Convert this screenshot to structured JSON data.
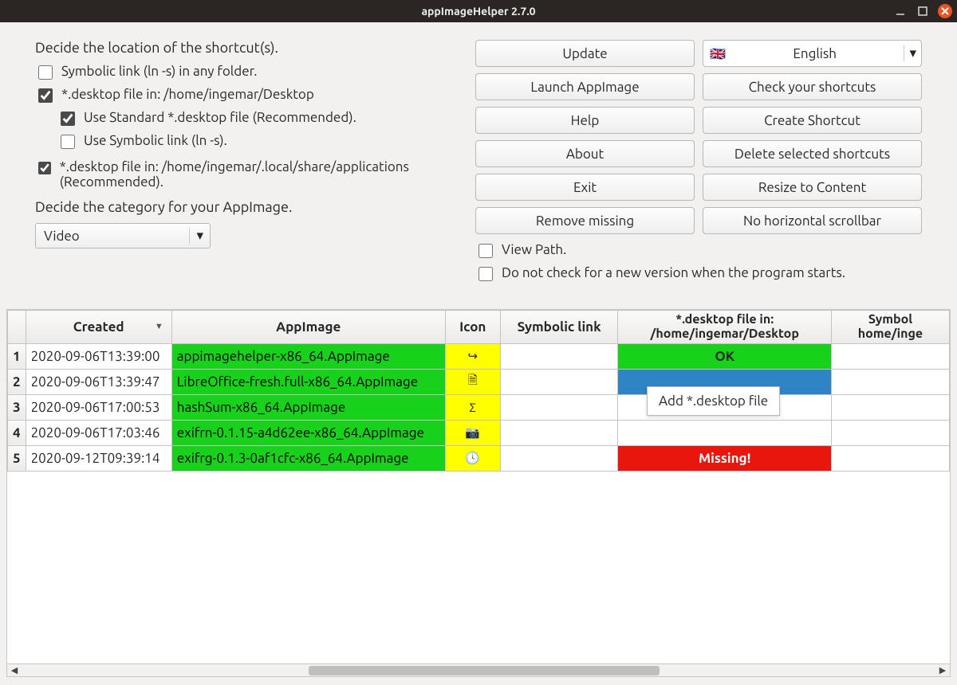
{
  "window": {
    "title": "appImageHelper 2.7.0"
  },
  "left": {
    "heading1": "Decide the location of the shortcut(s).",
    "cb_symlink": "Symbolic link (ln -s) in any folder.",
    "cb_desktop_file": "*.desktop file in: /home/ingemar/Desktop",
    "cb_use_standard": "Use Standard *.desktop file (Recommended).",
    "cb_use_symlink": "Use Symbolic link (ln -s).",
    "cb_local_apps": "*.desktop file in: /home/ingemar/.local/share/applications (Recommended).",
    "heading2": "Decide the category for your AppImage.",
    "category": "Video"
  },
  "buttons": {
    "update": "Update",
    "launch": "Launch AppImage",
    "help": "Help",
    "about": "About",
    "exit": "Exit",
    "remove_missing": "Remove missing",
    "check_shortcuts": "Check your shortcuts",
    "create_shortcut": "Create Shortcut",
    "delete_shortcuts": "Delete selected shortcuts",
    "resize": "Resize to Content",
    "no_hscroll": "No horizontal scrollbar"
  },
  "lang": {
    "flag": "🇬🇧",
    "name": "English"
  },
  "right_checks": {
    "view_path": "View Path.",
    "no_update_check": "Do not check for a new version when the program starts."
  },
  "table": {
    "headers": {
      "created": "Created",
      "appimage": "AppImage",
      "icon": "Icon",
      "symlink": "Symbolic link",
      "desktop1": "*.desktop file in: /home/ingemar/Desktop",
      "desktop2": "Symbol\nhome/inge"
    },
    "rows": [
      {
        "n": "1",
        "created": "2020-09-06T13:39:00",
        "app": "appimagehelper-x86_64.AppImage",
        "icon": "↪",
        "d1": "OK",
        "d1cls": "ok"
      },
      {
        "n": "2",
        "created": "2020-09-06T13:39:47",
        "app": "LibreOffice-fresh.full-x86_64.AppImage",
        "icon": "🗎",
        "d1": "",
        "d1cls": "sel"
      },
      {
        "n": "3",
        "created": "2020-09-06T17:00:53",
        "app": "hashSum-x86_64.AppImage",
        "icon": "Σ",
        "d1": "",
        "d1cls": ""
      },
      {
        "n": "4",
        "created": "2020-09-06T17:03:46",
        "app": "exifrn-0.1.15-a4d62ee-x86_64.AppImage",
        "icon": "📷",
        "d1": "",
        "d1cls": ""
      },
      {
        "n": "5",
        "created": "2020-09-12T09:39:14",
        "app": "exifrg-0.1.3-0af1cfc-x86_64.AppImage",
        "icon": "🕓",
        "d1": "Missing!",
        "d1cls": "missing"
      }
    ]
  },
  "context_menu": {
    "add": "Add *.desktop file"
  },
  "colors": {
    "accent_orange": "#e95420",
    "green": "#17d11a",
    "yellow": "#ffff00",
    "blue": "#2f84c6",
    "red": "#e8160d"
  }
}
